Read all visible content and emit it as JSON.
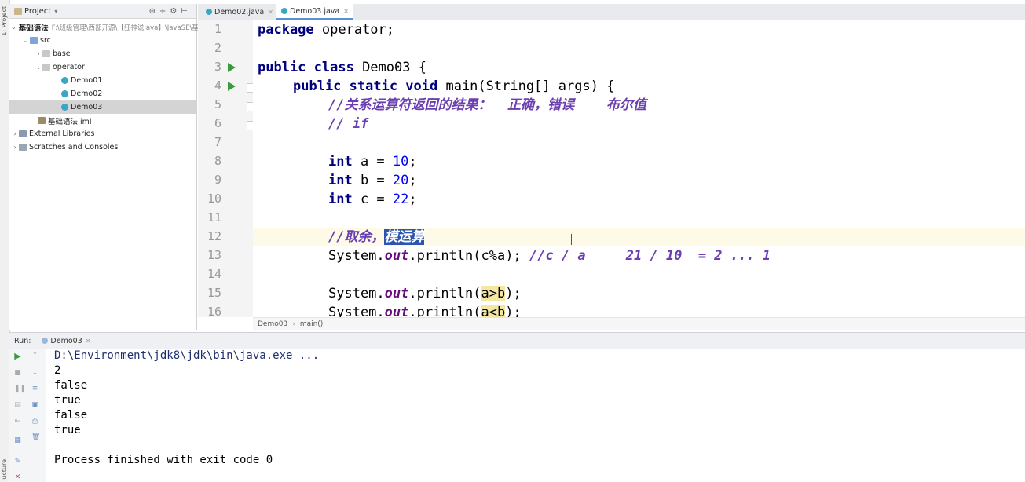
{
  "left_stripe": {
    "top_label": "1: Project",
    "bottom_label": "ucture"
  },
  "project_panel": {
    "title": "Project",
    "tree": [
      {
        "label": "基础语法",
        "path": "F:\\班级管理\\西部开源\\【狂神说Java】\\JavaSE\\基础",
        "type": "module",
        "expanded": true
      },
      {
        "label": "src",
        "type": "src-folder",
        "expanded": true
      },
      {
        "label": "base",
        "type": "package",
        "expanded": false
      },
      {
        "label": "operator",
        "type": "package",
        "expanded": true
      },
      {
        "label": "Demo01",
        "type": "class"
      },
      {
        "label": "Demo02",
        "type": "class"
      },
      {
        "label": "Demo03",
        "type": "class",
        "selected": true
      },
      {
        "label": "基础语法.iml",
        "type": "iml"
      },
      {
        "label": "External Libraries",
        "type": "library",
        "expanded": false
      },
      {
        "label": "Scratches and Consoles",
        "type": "scratches",
        "expanded": false
      }
    ]
  },
  "editor_tabs": [
    {
      "label": "Demo02.java",
      "active": false
    },
    {
      "label": "Demo03.java",
      "active": true
    }
  ],
  "line_numbers": [
    "1",
    "2",
    "3",
    "4",
    "5",
    "6",
    "7",
    "8",
    "9",
    "10",
    "11",
    "12",
    "13",
    "14",
    "15",
    "16"
  ],
  "code": {
    "l1": {
      "kw": "package",
      "rest": " operator;"
    },
    "l3": {
      "kw": "public class",
      "rest": " Demo03 {"
    },
    "l4": {
      "kw": "public static void",
      "rest": " main(String[] args) {"
    },
    "l5": "//关系运算符返回的结果：  正确，错误    布尔值",
    "l6": "// if",
    "l8": {
      "kw": "int",
      "pre": " a = ",
      "num": "10",
      "post": ";"
    },
    "l9": {
      "kw": "int",
      "pre": " b = ",
      "num": "20",
      "post": ";"
    },
    "l10": {
      "kw": "int",
      "pre": " c = ",
      "num": "22",
      "post": ";"
    },
    "l12": {
      "cmt": "//取余，",
      "sel": "模运算"
    },
    "l13": {
      "a": "System.",
      "fld": "out",
      "b": ".println(c%a); ",
      "cmt": "//c / a     21 / 10  = 2 ... 1"
    },
    "l15": {
      "a": "System.",
      "fld": "out",
      "b": ".println(",
      "hl": "a>b",
      "c": ");"
    },
    "l16": {
      "a": "System.",
      "fld": "out",
      "b": ".println(",
      "hl": "a<b",
      "c": ");"
    }
  },
  "breadcrumb": [
    "Demo03",
    "main()"
  ],
  "run_panel": {
    "label": "Run:",
    "tab": "Demo03",
    "output": [
      "D:\\Environment\\jdk8\\jdk\\bin\\java.exe ...",
      "2",
      "false",
      "true",
      "false",
      "true",
      "",
      "Process finished with exit code 0"
    ]
  },
  "colors": {
    "keyword": "#000080",
    "number": "#0000ff",
    "comment": "#6b3fb0",
    "selection": "#2d55b0",
    "run_green": "#3b9a3b"
  }
}
